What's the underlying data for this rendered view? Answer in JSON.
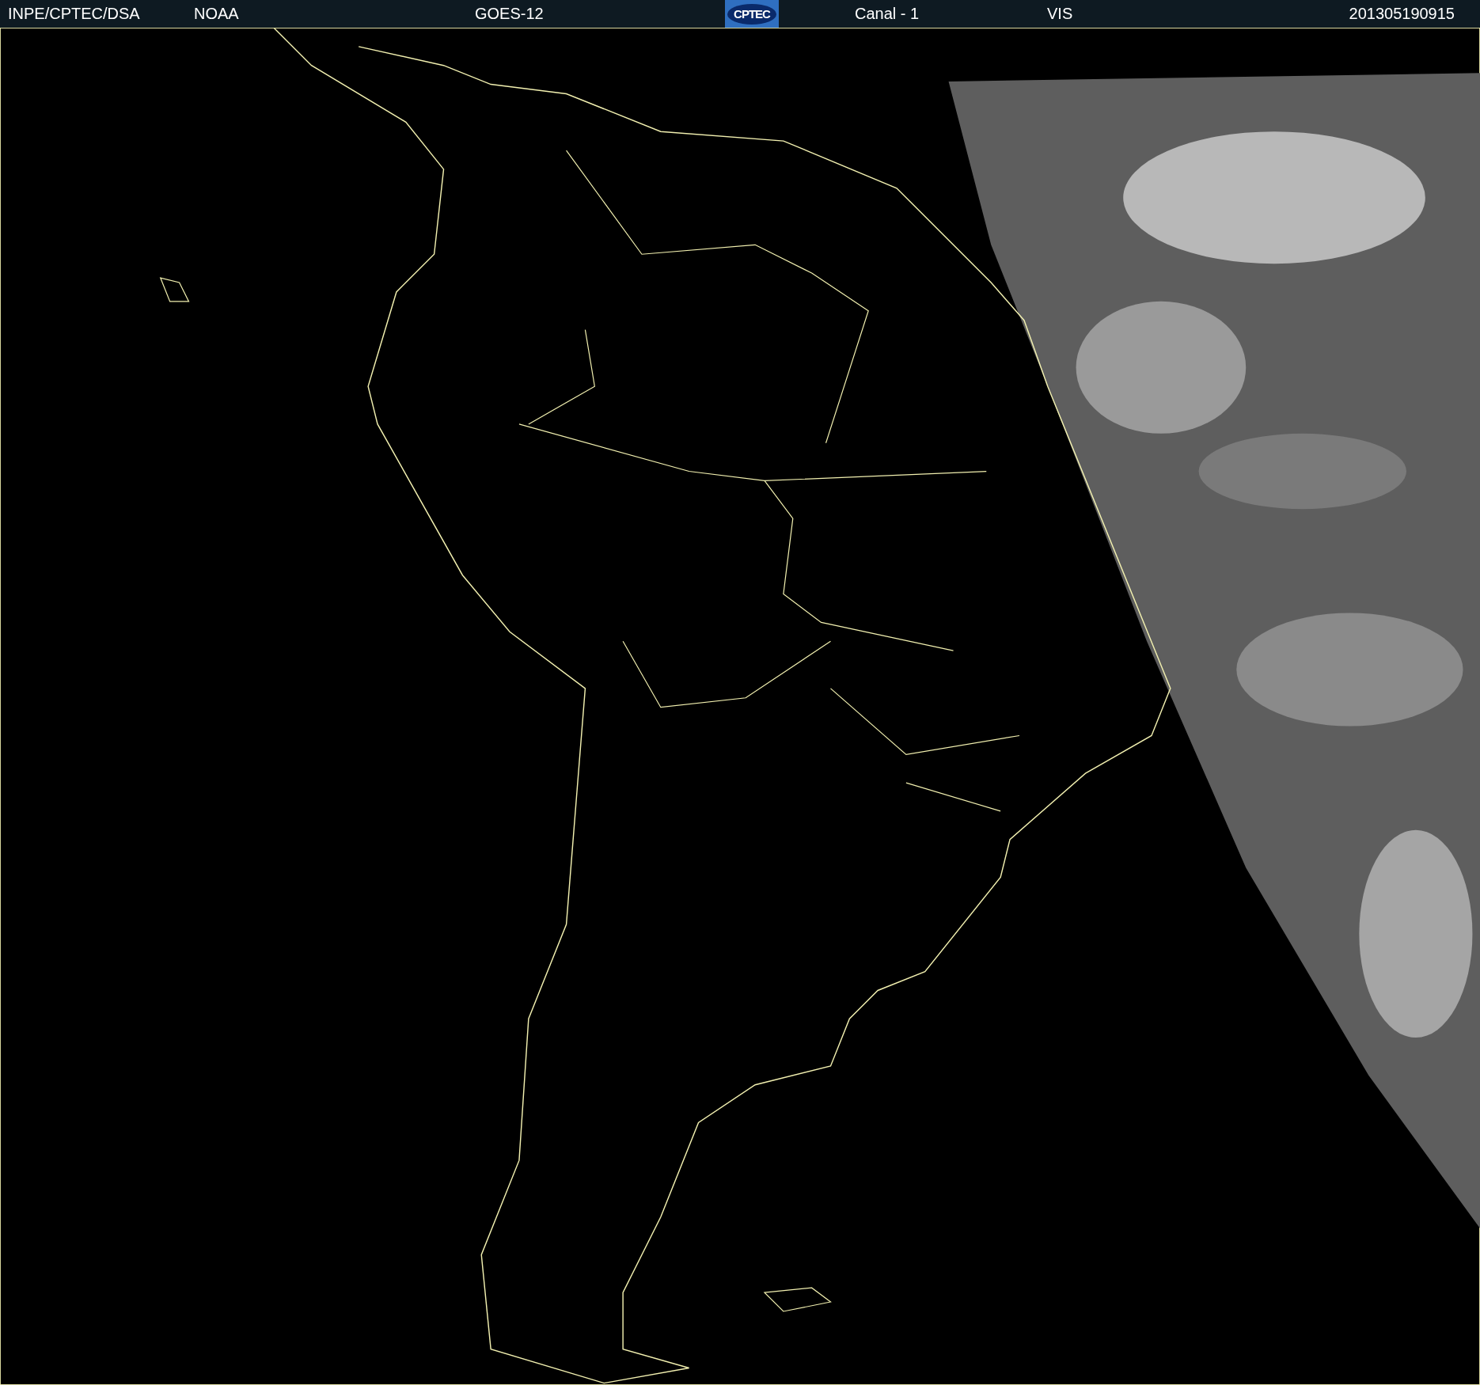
{
  "header": {
    "items": [
      {
        "kind": "text",
        "text": "INPE/CPTEC/DSA"
      },
      {
        "kind": "text",
        "text": "NOAA"
      },
      {
        "kind": "text",
        "text": "GOES-12"
      },
      {
        "kind": "logo",
        "text": "CPTEC"
      },
      {
        "kind": "text",
        "text": "Canal - 1"
      },
      {
        "kind": "text",
        "text": "VIS"
      },
      {
        "kind": "text",
        "text": "201305190915"
      }
    ]
  }
}
